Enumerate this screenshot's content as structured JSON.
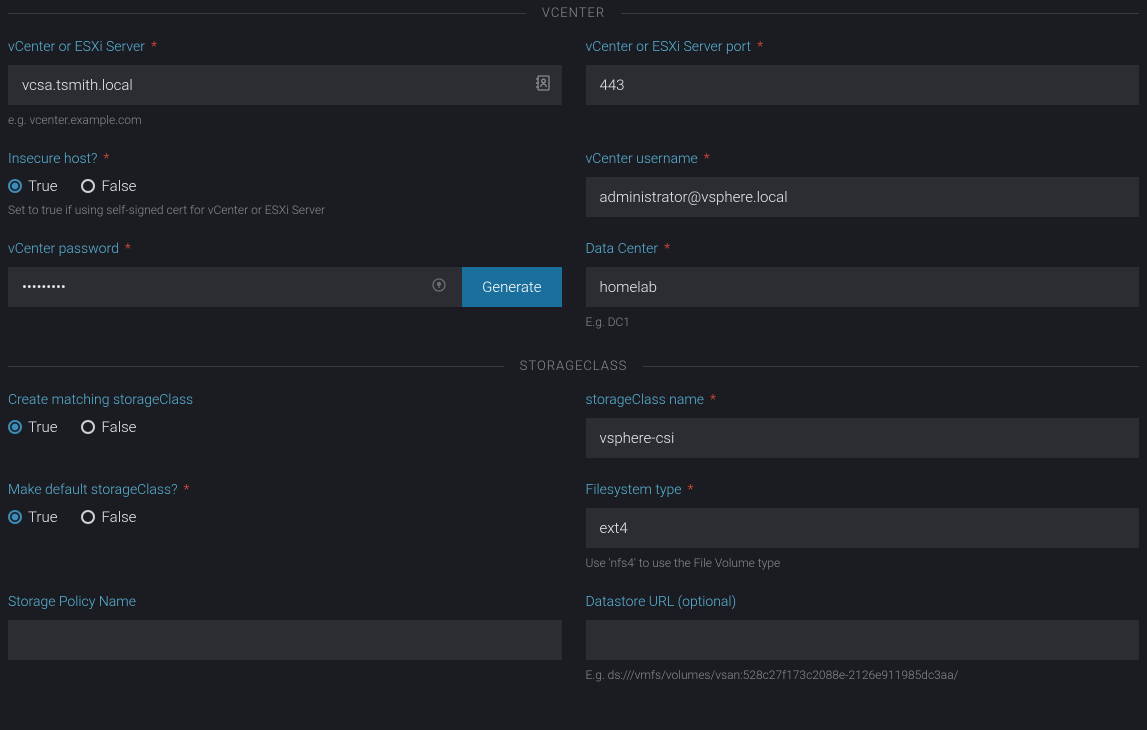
{
  "sections": {
    "vcenter": {
      "title": "VCENTER"
    },
    "storageclass": {
      "title": "STORAGECLASS"
    }
  },
  "radio": {
    "true": "True",
    "false": "False"
  },
  "vcenter": {
    "server": {
      "label": "vCenter or ESXi Server",
      "value": "vcsa.tsmith.local",
      "hint": "e.g. vcenter.example.com"
    },
    "port": {
      "label": "vCenter or ESXi Server port",
      "value": "443"
    },
    "insecure": {
      "label": "Insecure host?",
      "value": "true",
      "hint": "Set to true if using self-signed cert for vCenter or ESXi Server"
    },
    "username": {
      "label": "vCenter username",
      "value": "administrator@vsphere.local"
    },
    "password": {
      "label": "vCenter password",
      "value": "•••••••••",
      "generate": "Generate"
    },
    "datacenter": {
      "label": "Data Center",
      "value": "homelab",
      "hint": "E.g. DC1"
    }
  },
  "sc": {
    "create": {
      "label": "Create matching storageClass",
      "value": "true"
    },
    "name": {
      "label": "storageClass name",
      "value": "vsphere-csi"
    },
    "default": {
      "label": "Make default storageClass?",
      "value": "true"
    },
    "fstype": {
      "label": "Filesystem type",
      "value": "ext4",
      "hint": "Use 'nfs4' to use the File Volume type"
    },
    "policy": {
      "label": "Storage Policy Name",
      "value": ""
    },
    "dsurl": {
      "label": "Datastore URL (optional)",
      "value": "",
      "hint": "E.g. ds:///vmfs/volumes/vsan:528c27f173c2088e-2126e911985dc3aa/"
    }
  }
}
